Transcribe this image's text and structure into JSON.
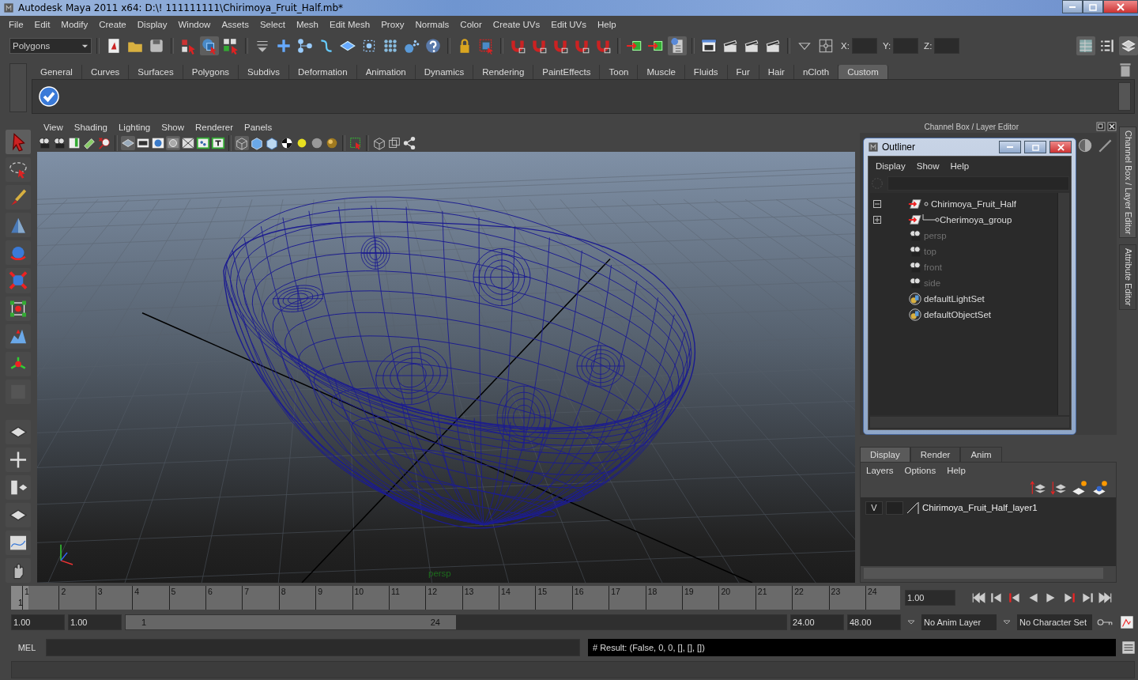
{
  "window": {
    "title": "Autodesk Maya 2011 x64: D:\\! 111111111\\Chirimoya_Fruit_Half.mb*"
  },
  "menu_bar": [
    "File",
    "Edit",
    "Modify",
    "Create",
    "Display",
    "Window",
    "Assets",
    "Select",
    "Mesh",
    "Edit Mesh",
    "Proxy",
    "Normals",
    "Color",
    "Create UVs",
    "Edit UVs",
    "Help"
  ],
  "status_line": {
    "mode_menu": "Polygons",
    "x_label": "X:",
    "y_label": "Y:",
    "z_label": "Z:"
  },
  "shelf": {
    "tabs": [
      {
        "label": "General",
        "selected": false
      },
      {
        "label": "Curves",
        "selected": false
      },
      {
        "label": "Surfaces",
        "selected": false
      },
      {
        "label": "Polygons",
        "selected": false
      },
      {
        "label": "Subdivs",
        "selected": false
      },
      {
        "label": "Deformation",
        "selected": false
      },
      {
        "label": "Animation",
        "selected": false
      },
      {
        "label": "Dynamics",
        "selected": false
      },
      {
        "label": "Rendering",
        "selected": false
      },
      {
        "label": "PaintEffects",
        "selected": false
      },
      {
        "label": "Toon",
        "selected": false
      },
      {
        "label": "Muscle",
        "selected": false
      },
      {
        "label": "Fluids",
        "selected": false
      },
      {
        "label": "Fur",
        "selected": false
      },
      {
        "label": "Hair",
        "selected": false
      },
      {
        "label": "nCloth",
        "selected": false
      },
      {
        "label": "Custom",
        "selected": true
      }
    ]
  },
  "viewport": {
    "menu": [
      "View",
      "Shading",
      "Lighting",
      "Show",
      "Renderer",
      "Panels"
    ],
    "camera_label": "persp"
  },
  "channel_box": {
    "title": "Channel Box / Layer Editor",
    "side_tabs": [
      {
        "label": "Channel Box / Layer Editor",
        "selected": true
      },
      {
        "label": "Attribute Editor",
        "selected": false
      }
    ]
  },
  "outliner": {
    "title": "Outliner",
    "menu": [
      "Display",
      "Show",
      "Help"
    ],
    "items": [
      {
        "label": "Chirimoya_Fruit_Half",
        "kind": "transform",
        "dimmed": false,
        "expanded": true,
        "children": [
          {
            "label": "Cherimoya_group",
            "kind": "transform",
            "dimmed": false,
            "expanded": false
          }
        ]
      },
      {
        "label": "persp",
        "kind": "camera",
        "dimmed": true
      },
      {
        "label": "top",
        "kind": "camera",
        "dimmed": true
      },
      {
        "label": "front",
        "kind": "camera",
        "dimmed": true
      },
      {
        "label": "side",
        "kind": "camera",
        "dimmed": true
      },
      {
        "label": "defaultLightSet",
        "kind": "set",
        "dimmed": false
      },
      {
        "label": "defaultObjectSet",
        "kind": "set",
        "dimmed": false
      }
    ]
  },
  "layer_editor": {
    "tabs": [
      {
        "label": "Display",
        "selected": true
      },
      {
        "label": "Render",
        "selected": false
      },
      {
        "label": "Anim",
        "selected": false
      }
    ],
    "menu": [
      "Layers",
      "Options",
      "Help"
    ],
    "layers": [
      {
        "visibility": "V",
        "name": "Chirimoya_Fruit_Half_layer1"
      }
    ]
  },
  "timeline": {
    "ticks": [
      "1",
      "2",
      "3",
      "4",
      "5",
      "6",
      "7",
      "8",
      "9",
      "10",
      "11",
      "12",
      "13",
      "14",
      "15",
      "16",
      "17",
      "18",
      "19",
      "20",
      "21",
      "22",
      "23",
      "24"
    ],
    "current_frame": "1",
    "level": 0,
    "current_time": "1.00"
  },
  "range": {
    "start": "1.00",
    "playback_start": "1.00",
    "slider_start": "1",
    "slider_end": "24",
    "level": 0.5,
    "playback_end": "24.00",
    "end": "48.00",
    "anim_layer": "No Anim Layer",
    "character_set": "No Character Set"
  },
  "command_line": {
    "label": "MEL",
    "result": "# Result: (False, 0, 0, [], [], [])"
  }
}
